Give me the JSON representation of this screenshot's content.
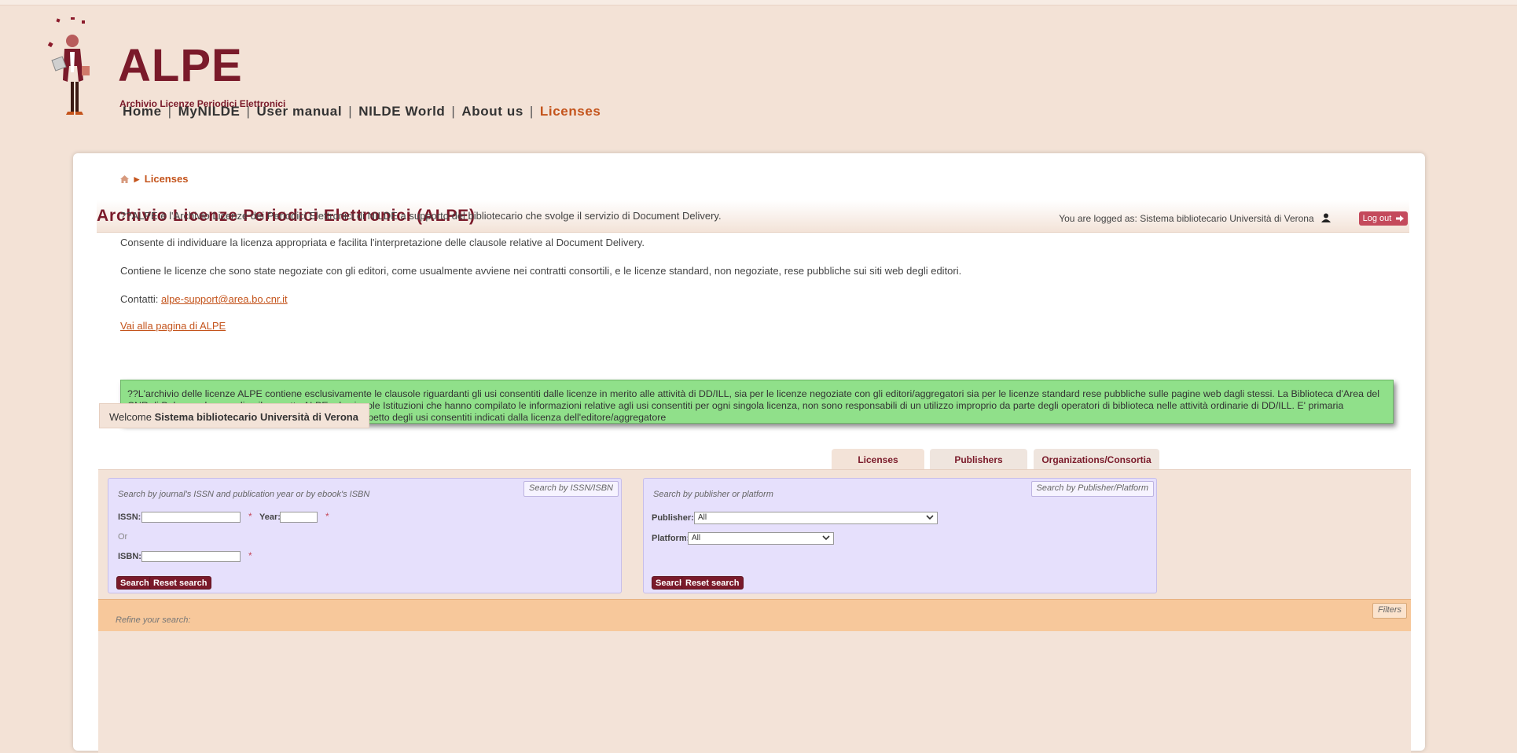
{
  "header": {
    "logo_title": "ALPE",
    "logo_subtitle": "Archivio Licenze Periodici Elettronici",
    "nav": [
      {
        "label": "Home"
      },
      {
        "label": "MyNILDE"
      },
      {
        "label": "User manual"
      },
      {
        "label": "NILDE World"
      },
      {
        "label": "About us"
      },
      {
        "label": "Licenses",
        "active": true
      }
    ]
  },
  "breadcrumb": {
    "home_icon": "home-icon",
    "separator": "▸",
    "current": "Licenses"
  },
  "title_bar": {
    "title": "Archivio Licenze Periodici Elettronici (ALPE)",
    "logged_text": "You are logged as: Sistema bibliotecario Università di Verona",
    "user_icon": "user-icon",
    "logout_label": "Log out"
  },
  "intro": {
    "p1": "??ALPE è l'Archivio Licenze dei Periodici Elettronici di NILDE a supporto del bibliotecario che svolge il servizio di Document Delivery.",
    "p2": "Consente di individuare la licenza appropriata e facilita l'interpretazione delle clausole relative al Document Delivery.",
    "p3": "Contiene le licenze che sono state negoziate con gli editori, come usualmente avviene nei contratti consortili, e le licenze standard, non negoziate, rese pubbliche sui siti web degli editori.",
    "contact_label": "Contatti:",
    "contact_email": "alpe-support@area.bo.cnr.it",
    "alpe_link": "Vai alla pagina di ALPE"
  },
  "notice": "??L'archivio delle licenze ALPE contiene esclusivamente le clausole riguardanti gli usi consentiti dalle licenze in merito alle attività di DD/ILL, sia per le licenze negoziate con gli editori/aggregatori sia per le licenze standard rese pubbliche sulle pagine web dagli stessi. La Biblioteca d'Area del CNR di Bologna che coordina il progetto ALPE e le singole Istituzioni che hanno compilato le informazioni relative agli usi consentiti per ogni singola licenza, non sono responsabili di un utilizzo improprio da parte degli operatori di biblioteca nelle attività ordinarie di DD/ILL. E' primaria responsabilità dell'operatore di biblioteca operare nel rispetto degli usi consentiti indicati dalla licenza dell'editore/aggregatore",
  "welcome": {
    "prefix": "Welcome",
    "name": "Sistema bibliotecario Università di Verona"
  },
  "tabs": [
    {
      "label": "Licenses",
      "active": true
    },
    {
      "label": "Publishers"
    },
    {
      "label": "Organizations/Consortia"
    }
  ],
  "issn_search": {
    "heading": "Search by journal's ISSN and publication year or by ebook's ISBN",
    "badge": "Search by ISSN/ISBN",
    "issn_label": "ISSN:",
    "issn_value": "",
    "year_label": "Year:",
    "year_value": "",
    "or_label": "Or",
    "isbn_label": "ISBN:",
    "isbn_value": "",
    "required_mark": "*",
    "search_label": "Search",
    "reset_label": "Reset search"
  },
  "publisher_search": {
    "heading": "Search by publisher or platform",
    "badge": "Search by Publisher/Platform",
    "publisher_label": "Publisher:",
    "publisher_value": "All",
    "platform_label": "Platform:",
    "platform_value": "All",
    "search_label": "Search",
    "reset_label": "Reset search"
  },
  "refine": {
    "text": "Refine your search:",
    "badge": "Filters"
  },
  "colors": {
    "brand": "#7a1a2a",
    "accent": "#c4541c",
    "notice_bg": "#90e08a",
    "search_box_bg": "#e6e0fc"
  }
}
